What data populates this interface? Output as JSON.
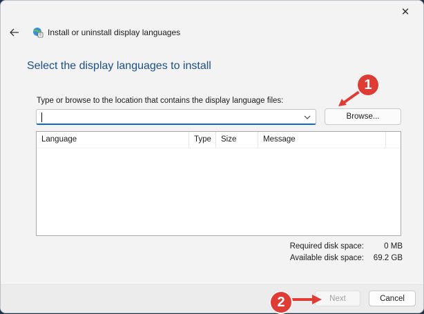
{
  "window": {
    "title": "Install or uninstall display languages",
    "close_glyph": "✕"
  },
  "heading": "Select the display languages to install",
  "path": {
    "label": "Type or browse to the location that contains the display language files:",
    "value": ""
  },
  "browse_label": "Browse...",
  "list": {
    "columns": [
      "Language",
      "Type",
      "Size",
      "Message"
    ]
  },
  "disk": {
    "required_label": "Required disk space:",
    "required_value": "0 MB",
    "available_label": "Available disk space:",
    "available_value": "69.2 GB"
  },
  "footer": {
    "next_label": "Next",
    "cancel_label": "Cancel"
  },
  "annotations": {
    "step1": "1",
    "step2": "2",
    "color": "#e03c36"
  },
  "icons": [
    "back-arrow-icon",
    "globe-icon",
    "chevron-down-icon",
    "close-icon"
  ]
}
